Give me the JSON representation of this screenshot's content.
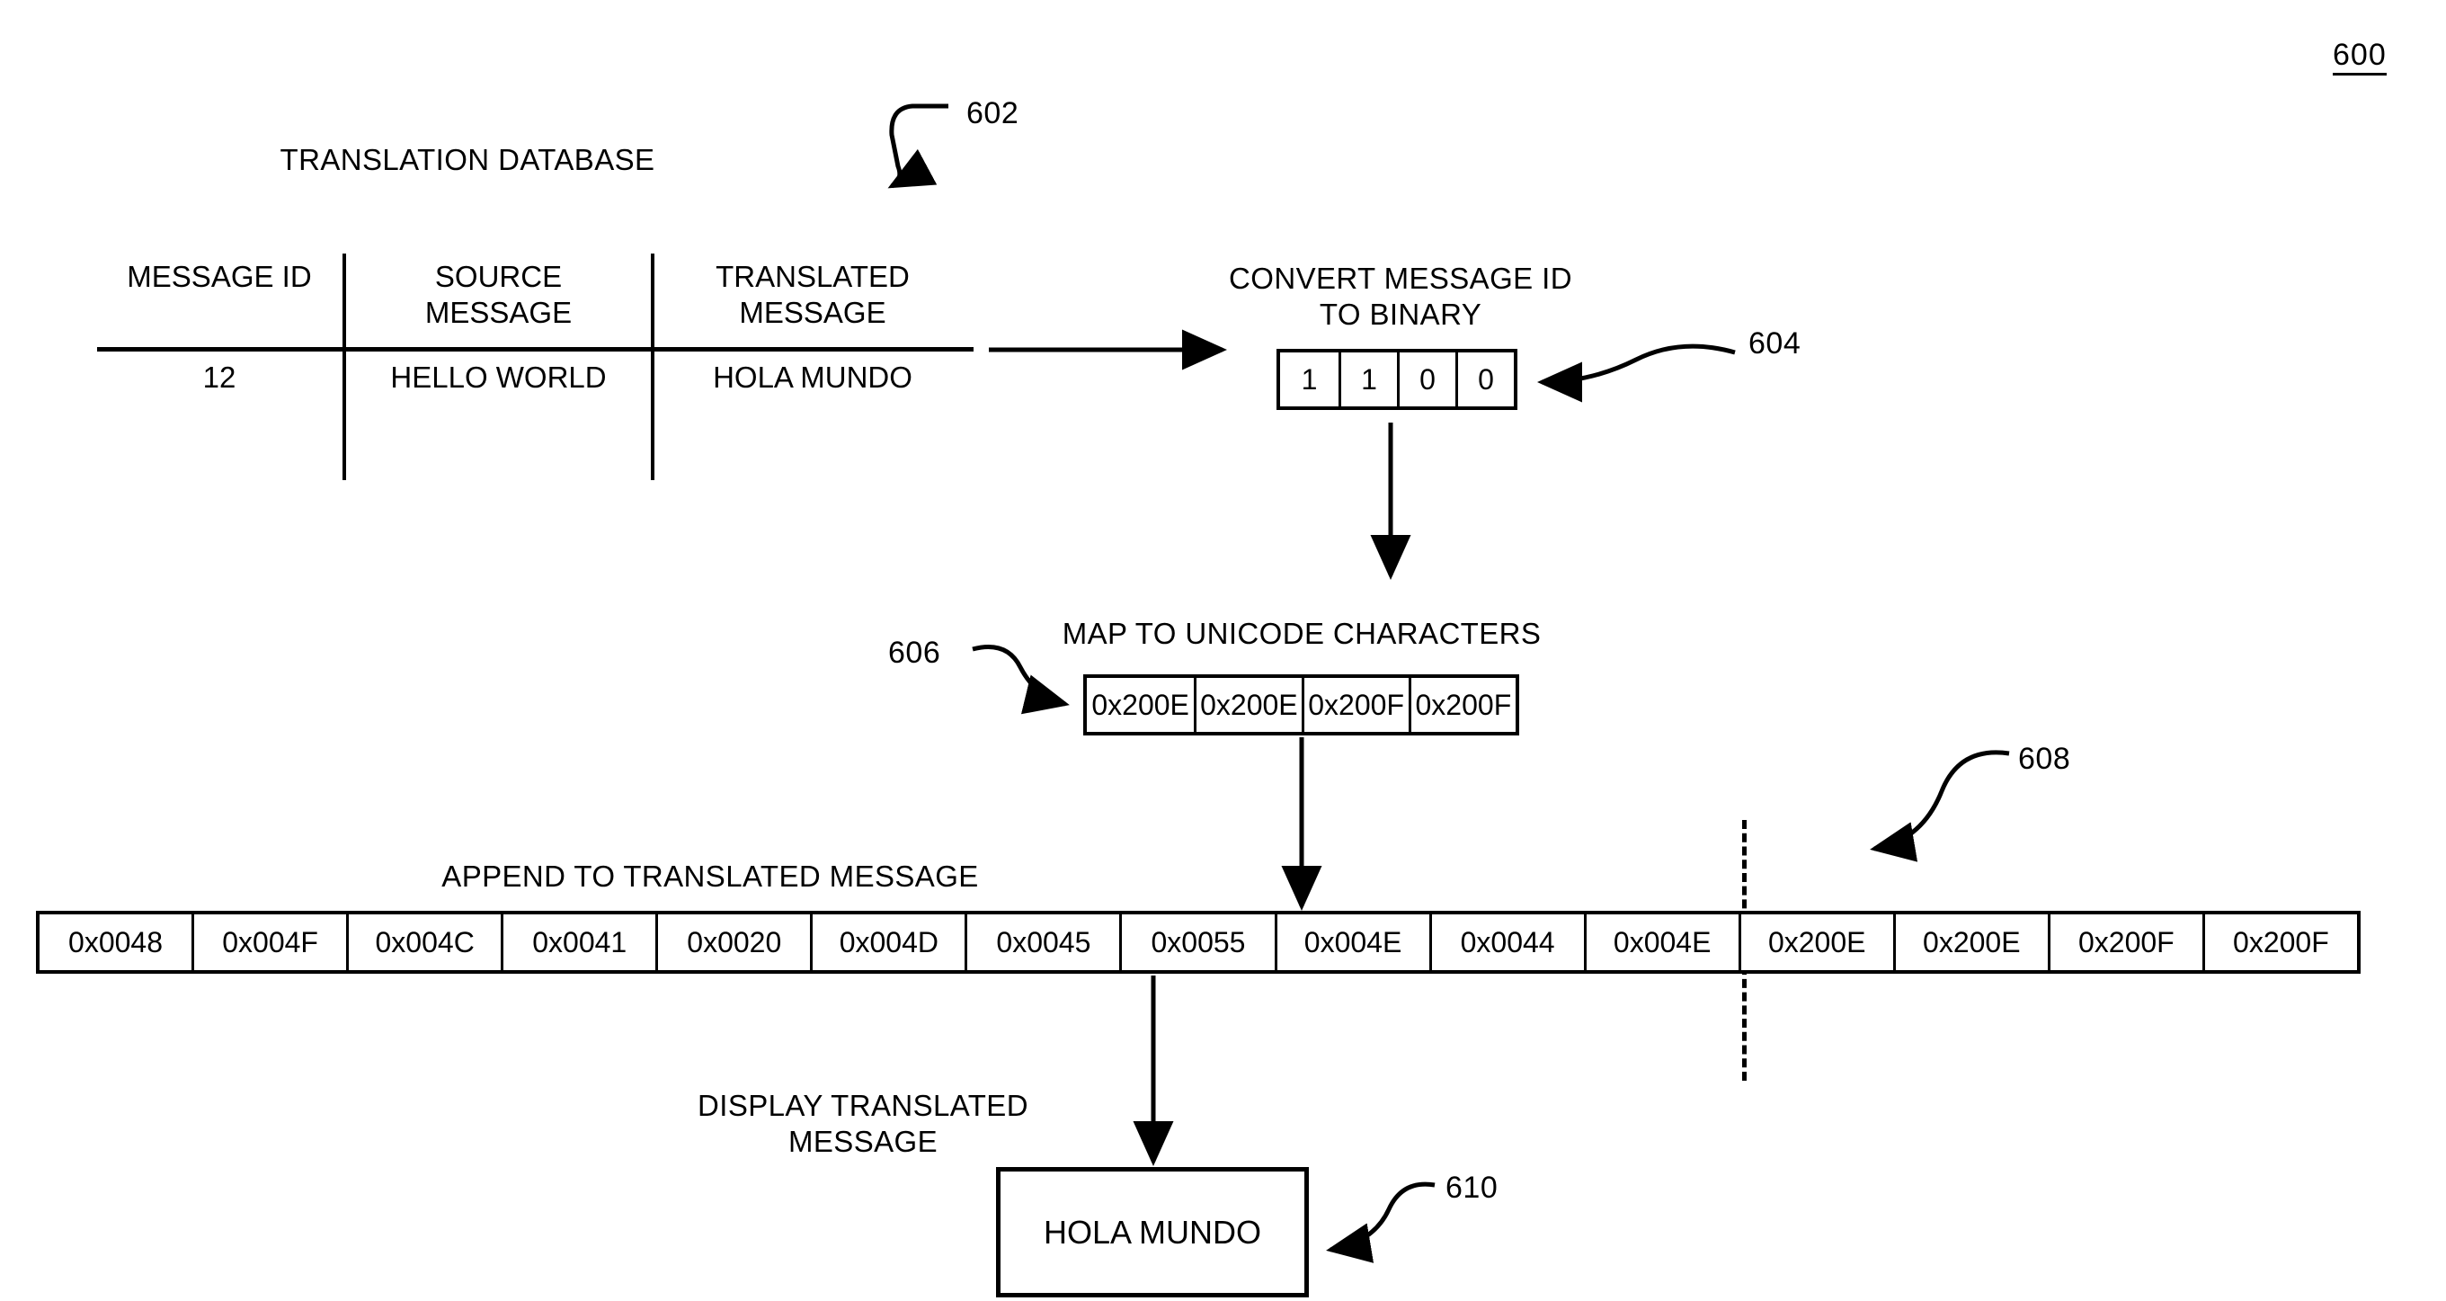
{
  "figure": {
    "number": "600"
  },
  "database": {
    "title": "TRANSLATION DATABASE",
    "ref": "602",
    "columns": [
      "MESSAGE ID",
      "SOURCE\nMESSAGE",
      "TRANSLATED\nMESSAGE"
    ],
    "rows": [
      [
        "12",
        "HELLO WORLD",
        "HOLA MUNDO"
      ]
    ]
  },
  "convert": {
    "title": "CONVERT MESSAGE ID\nTO BINARY",
    "ref": "604",
    "bits": [
      "1",
      "1",
      "0",
      "0"
    ]
  },
  "map": {
    "title": "MAP TO UNICODE CHARACTERS",
    "ref": "606",
    "codes": [
      "0x200E",
      "0x200E",
      "0x200F",
      "0x200F"
    ]
  },
  "append": {
    "title": "APPEND TO TRANSLATED MESSAGE",
    "ref": "608",
    "codes": [
      "0x0048",
      "0x004F",
      "0x004C",
      "0x0041",
      "0x0020",
      "0x004D",
      "0x0045",
      "0x0055",
      "0x004E",
      "0x0044",
      "0x004E",
      "0x200E",
      "0x200E",
      "0x200F",
      "0x200F"
    ]
  },
  "display": {
    "title": "DISPLAY TRANSLATED\nMESSAGE",
    "ref": "610",
    "message": "HOLA MUNDO"
  }
}
